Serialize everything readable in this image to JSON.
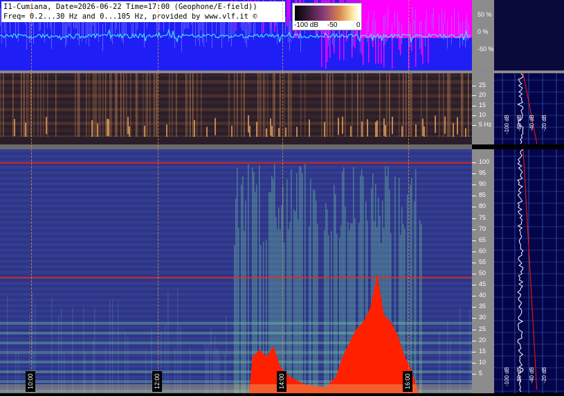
{
  "header": {
    "line1": "I1-Cumiana, Date=2026-06-22 Time=17:00 (Geophone/E-field))",
    "line2": "Freq= 0.2...30 Hz and 0...105 Hz, provided by www.vlf.it ©"
  },
  "colorbar": {
    "min_label": "-100 dB",
    "mid_label": "-50",
    "max_label": "0"
  },
  "waveform_axis": [
    {
      "label": "50 %",
      "value": 50
    },
    {
      "label": "0 %",
      "value": 0
    },
    {
      "label": "-50 %",
      "value": -50
    }
  ],
  "low_axis": {
    "range": [
      0,
      30
    ],
    "ticks": [
      {
        "label": "25",
        "value": 25
      },
      {
        "label": "20",
        "value": 20
      },
      {
        "label": "15",
        "value": 15
      },
      {
        "label": "10",
        "value": 10
      },
      {
        "label": "5 Hz",
        "value": 5
      }
    ]
  },
  "high_axis": {
    "range": [
      0,
      105
    ],
    "ticks": [
      {
        "label": "100",
        "value": 100
      },
      {
        "label": "95",
        "value": 95
      },
      {
        "label": "90",
        "value": 90
      },
      {
        "label": "85",
        "value": 85
      },
      {
        "label": "80",
        "value": 80
      },
      {
        "label": "75",
        "value": 75
      },
      {
        "label": "70",
        "value": 70
      },
      {
        "label": "65",
        "value": 65
      },
      {
        "label": "60",
        "value": 60
      },
      {
        "label": "55",
        "value": 55
      },
      {
        "label": "50",
        "value": 50
      },
      {
        "label": "45",
        "value": 45
      },
      {
        "label": "40",
        "value": 40
      },
      {
        "label": "35",
        "value": 35
      },
      {
        "label": "30",
        "value": 30
      },
      {
        "label": "25",
        "value": 25
      },
      {
        "label": "20",
        "value": 20
      },
      {
        "label": "15",
        "value": 15
      },
      {
        "label": "10",
        "value": 10
      },
      {
        "label": "5",
        "value": 5
      }
    ]
  },
  "time_markers": [
    "10:00",
    "12:00",
    "14:00",
    "16:00"
  ],
  "side_labels": [
    "-100 dB",
    "-80 dB",
    "-40 dB",
    "-20 dB"
  ],
  "colors": {
    "waveform_bg": "#1f1ff5",
    "magenta": "#ff00ff",
    "cyan": "#40e0ff",
    "red": "#ff2000"
  }
}
